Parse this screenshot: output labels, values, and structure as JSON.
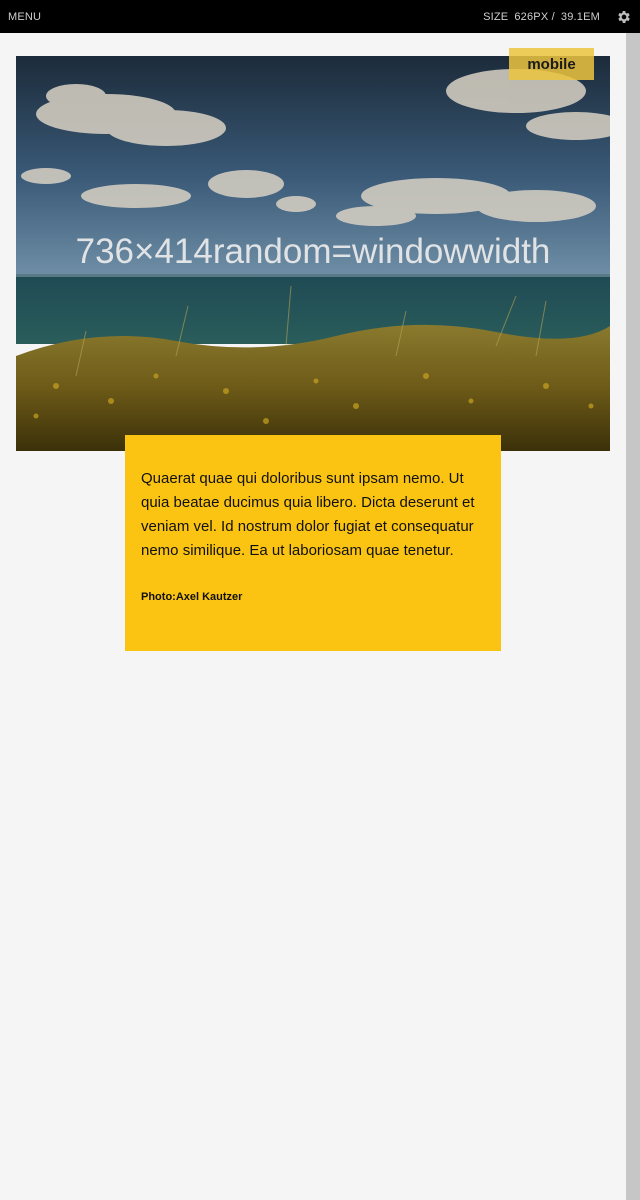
{
  "topbar": {
    "menu_label": "MENU",
    "size_label": "SIZE",
    "size_px": "626PX /",
    "size_em": "39.1EM",
    "settings_icon": "gear-icon"
  },
  "hero": {
    "placeholder_text": "736×414random=windowwidth",
    "badge_label": "mobile"
  },
  "caption_card": {
    "body": "Quaerat quae qui doloribus sunt ipsam nemo. Ut quia beatae ducimus quia libero. Dicta deserunt et veniam vel. Id nostrum dolor fugiat et consequatur nemo similique. Ea ut laboriosam quae tenetur.",
    "credit": "Photo:Axel Kautzer"
  },
  "colors": {
    "topbar_bg": "#000000",
    "card_bg": "#fbc412",
    "badge_bg": "#ecc43e",
    "page_bg": "#f5f5f5"
  }
}
